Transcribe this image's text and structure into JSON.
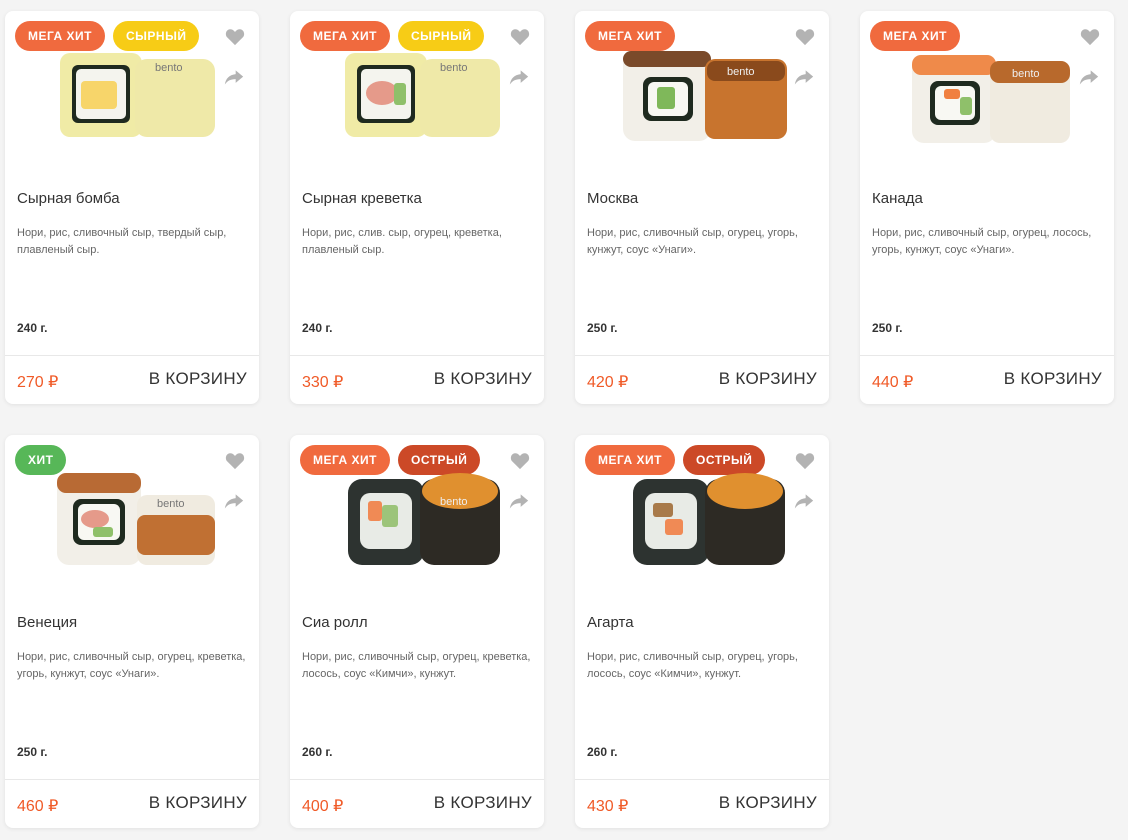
{
  "colors": {
    "accent": "#f05a27",
    "badge_mega": "#f06a3e",
    "badge_cheese": "#f7cc16",
    "badge_spicy": "#cc4927",
    "badge_hit": "#57b758"
  },
  "products": [
    {
      "badges": [
        "МЕГА ХИТ",
        "СЫРНЫЙ"
      ],
      "name": "Сырная бомба",
      "desc": "Нори, рис, сливочный сыр, твердый сыр, плавленый сыр.",
      "weight": "240 г.",
      "price": "270 ₽",
      "cart": "В КОРЗИНУ",
      "image": "cheese-roll-photo"
    },
    {
      "badges": [
        "МЕГА ХИТ",
        "СЫРНЫЙ"
      ],
      "name": "Сырная креветка",
      "desc": "Нори, рис, слив. сыр, огурец, креветка, плавленый сыр.",
      "weight": "240 г.",
      "price": "330 ₽",
      "cart": "В КОРЗИНУ",
      "image": "cheese-shrimp-roll-photo"
    },
    {
      "badges": [
        "МЕГА ХИТ"
      ],
      "name": "Москва",
      "desc": "Нори, рис, сливочный сыр, огурец, угорь, кунжут, соус «Унаги».",
      "weight": "250 г.",
      "price": "420 ₽",
      "cart": "В КОРЗИНУ",
      "image": "eel-roll-photo"
    },
    {
      "badges": [
        "МЕГА ХИТ"
      ],
      "name": "Канада",
      "desc": "Нори, рис, сливочный сыр, огурец, лосось, угорь, кунжут, соус «Унаги».",
      "weight": "250 г.",
      "price": "440 ₽",
      "cart": "В КОРЗИНУ",
      "image": "salmon-eel-roll-photo"
    },
    {
      "badges": [
        "ХИТ"
      ],
      "name": "Венеция",
      "desc": "Нори, рис, сливочный сыр, огурец, креветка, угорь, кунжут, соус «Унаги».",
      "weight": "250 г.",
      "price": "460 ₽",
      "cart": "В КОРЗИНУ",
      "image": "shrimp-eel-roll-photo"
    },
    {
      "badges": [
        "МЕГА ХИТ",
        "ОСТРЫЙ"
      ],
      "name": "Сиа ролл",
      "desc": "Нори, рис, сливочный сыр, огурец, креветка, лосось, соус «Кимчи», кунжут.",
      "weight": "260 г.",
      "price": "400 ₽",
      "cart": "В КОРЗИНУ",
      "image": "sesame-roll-photo"
    },
    {
      "badges": [
        "МЕГА ХИТ",
        "ОСТРЫЙ"
      ],
      "name": "Агарта",
      "desc": "Нори, рис, сливочный сыр, огурец, угорь, лосось, соус «Кимчи», кунжут.",
      "weight": "260 г.",
      "price": "430 ₽",
      "cart": "В КОРЗИНУ",
      "image": "black-sesame-roll-photo"
    }
  ]
}
